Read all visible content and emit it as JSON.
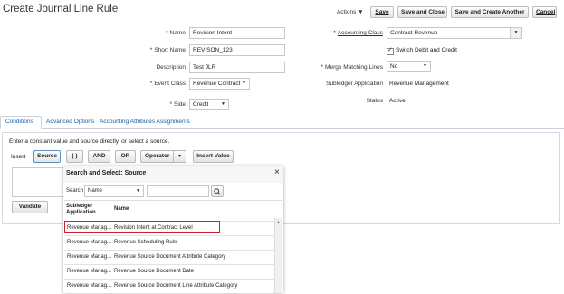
{
  "page": {
    "title": "Create Journal Line Rule"
  },
  "toolbar": {
    "actions_label": "Actions ▼",
    "save_label": "Save",
    "save_close_label": "Save and Close",
    "save_create_label": "Save and Create Another",
    "cancel_label": "Cancel"
  },
  "form": {
    "name_label": "Name",
    "name_value": "Revision Intent",
    "short_name_label": "Short Name",
    "short_name_value": "REVISON_123",
    "description_label": "Description",
    "description_value": "Test JLR",
    "event_class_label": "Event Class",
    "event_class_value": "Revenue Contract",
    "side_label": "Side",
    "side_value": "Credit",
    "accounting_class_label": "Accounting Class",
    "accounting_class_value": "Contract Revenue",
    "switch_label": "Switch Debit and Credit",
    "merge_label": "Merge Matching Lines",
    "merge_value": "No",
    "subledger_label": "Subledger Application",
    "subledger_value": "Revenue Management",
    "status_label": "Status",
    "status_value": "Active",
    "required_mark": "*"
  },
  "tabs": [
    {
      "label": "Conditions"
    },
    {
      "label": "Advanced Options"
    },
    {
      "label": "Accounting Attributes Assignments"
    }
  ],
  "conditions": {
    "instruction": "Enter a constant value and source directly, or select a source.",
    "insert_label": "Insert",
    "source_btn": "Source",
    "paren_btn": "( )",
    "and_btn": "AND",
    "or_btn": "OR",
    "operator_btn": "Operator",
    "insert_value_btn": "Insert Value",
    "validate_btn": "Validate"
  },
  "popup": {
    "title": "Search and Select: Source",
    "close": "×",
    "search_label": "Search",
    "search_field_value": "Name",
    "col_subledger": "Subledger Application",
    "col_name": "Name",
    "rows": [
      {
        "app": "Revenue Manag...",
        "name": "Revision Intent at Contract Level"
      },
      {
        "app": "Revenue Manag...",
        "name": "Revenue Scheduling Rule"
      },
      {
        "app": "Revenue Manag...",
        "name": "Revenue Source Document Attribute Category"
      },
      {
        "app": "Revenue Manag...",
        "name": "Revenue Source Document Date"
      },
      {
        "app": "Revenue Manag...",
        "name": "Revenue Source Document Line Attribute Category"
      }
    ]
  },
  "colors": {
    "link": "#145c9e",
    "highlight": "#d0202a"
  }
}
